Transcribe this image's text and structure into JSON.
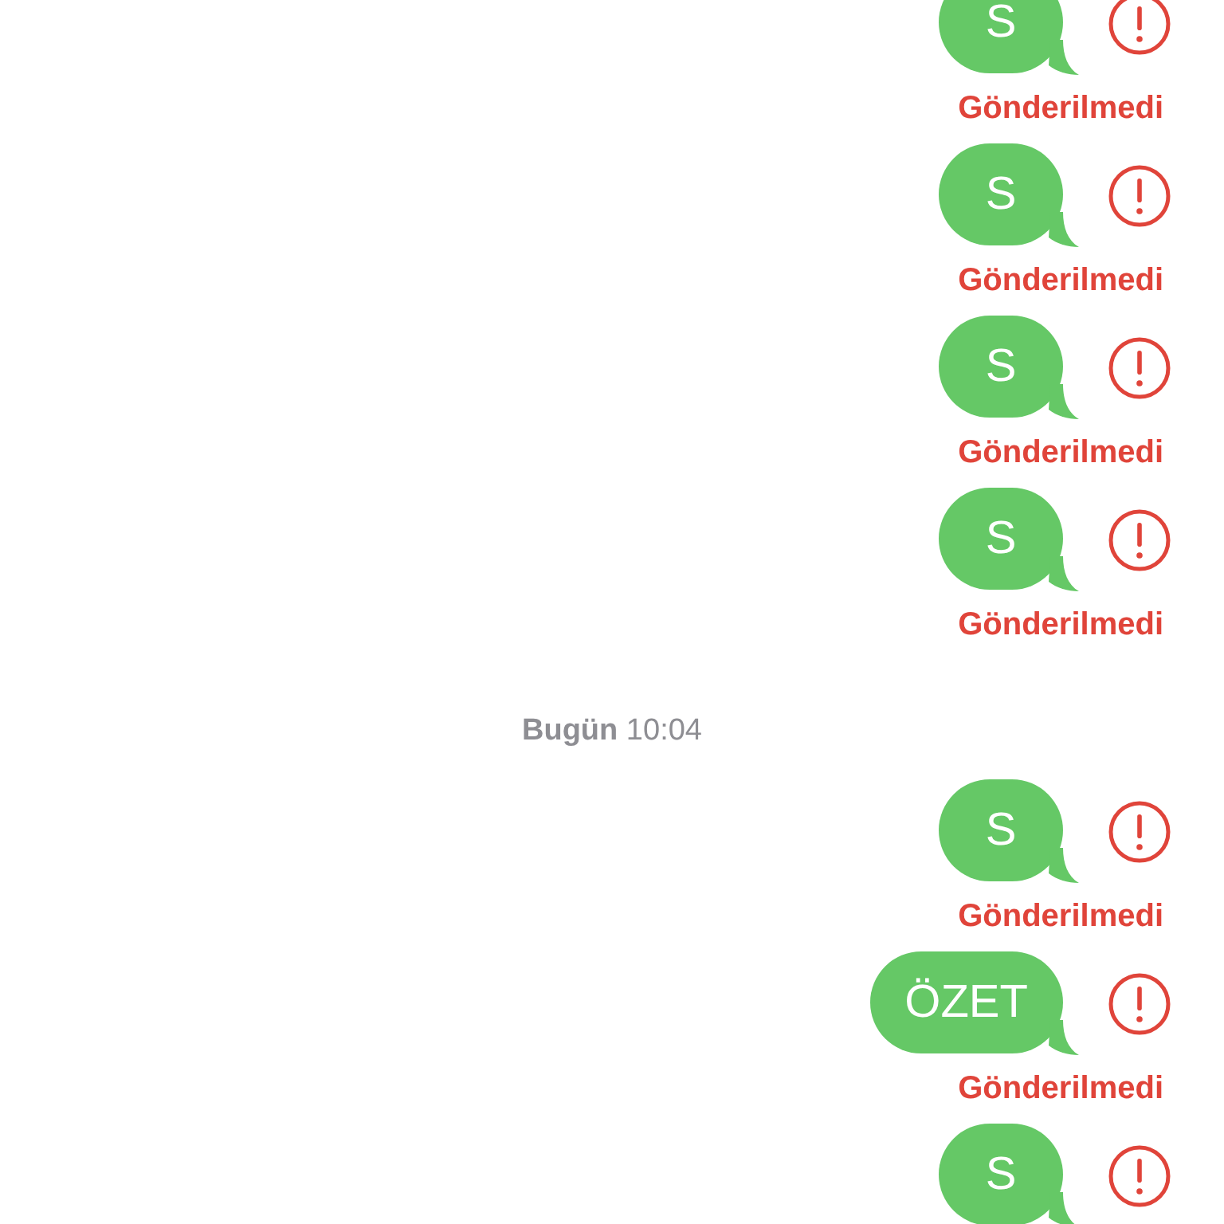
{
  "conversation": [
    {
      "kind": "message",
      "text": "S",
      "failed": true,
      "status": "Gönderilmedi"
    },
    {
      "kind": "message",
      "text": "S",
      "failed": true,
      "status": "Gönderilmedi"
    },
    {
      "kind": "message",
      "text": "S",
      "failed": true,
      "status": "Gönderilmedi"
    },
    {
      "kind": "message",
      "text": "S",
      "failed": true,
      "status": "Gönderilmedi"
    },
    {
      "kind": "timestamp",
      "text": "**Bugün** 10:04"
    },
    {
      "kind": "message",
      "text": "S",
      "failed": true,
      "status": "Gönderilmedi"
    },
    {
      "kind": "message",
      "text": "ÖZET",
      "failed": true,
      "status": "Gönderilmedi"
    },
    {
      "kind": "message",
      "text": "S",
      "failed": true
    }
  ]
}
